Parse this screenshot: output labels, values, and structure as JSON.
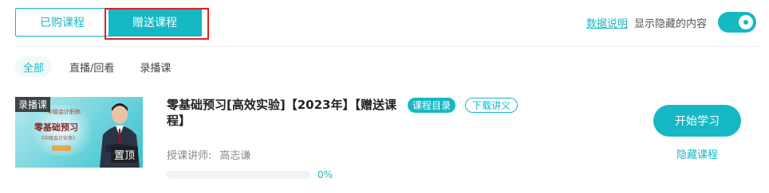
{
  "top_tabs": [
    "已购课程",
    "赠送课程"
  ],
  "top_right": {
    "data_link": "数据说明",
    "hidden_label": "显示隐藏的内容",
    "toggle_on": true
  },
  "filters": [
    "全部",
    "直播/回看",
    "录播课"
  ],
  "course": {
    "thumbnail": {
      "badge_recorded": "录播课",
      "badge_pinned": "置顶",
      "line1": "中级会计职称",
      "line2": "零基础预习",
      "line3": "《中级会计实务》",
      "pill": "高志谦"
    },
    "title": "零基础预习[高效实验]【2023年】【赠送课程】",
    "tag_catalog": "课程目录",
    "tag_download": "下载讲义",
    "teacher_label": "授课讲师:",
    "teacher_name": "高志谦",
    "progress": 0,
    "progress_text": "0%",
    "start_button": "开始学习",
    "hide_link": "隐藏课程"
  },
  "colors": {
    "accent": "#16b8c4",
    "highlight_box": "#e02020"
  }
}
